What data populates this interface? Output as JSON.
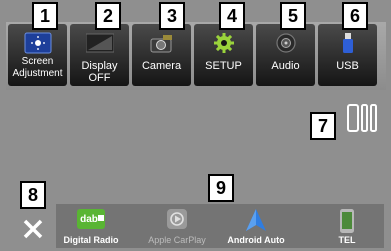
{
  "top_menu": [
    {
      "number": "1",
      "label": "Screen Adjustment",
      "icon": "screen-adjust-icon"
    },
    {
      "number": "2",
      "label": "Display OFF",
      "icon": "display-off-icon"
    },
    {
      "number": "3",
      "label": "Camera",
      "icon": "camera-icon"
    },
    {
      "number": "4",
      "label": "SETUP",
      "icon": "gear-icon"
    },
    {
      "number": "5",
      "label": "Audio",
      "icon": "speaker-icon"
    },
    {
      "number": "6",
      "label": "USB",
      "icon": "usb-icon"
    }
  ],
  "callouts": {
    "phone": "7",
    "close": "8",
    "dock": "9"
  },
  "dock": [
    {
      "label": "Digital Radio",
      "icon": "dab-icon",
      "enabled": true
    },
    {
      "label": "Apple CarPlay",
      "icon": "carplay-icon",
      "enabled": false
    },
    {
      "label": "Android Auto",
      "icon": "android-auto-icon",
      "enabled": true
    },
    {
      "label": "TEL",
      "icon": "phone-icon",
      "enabled": true
    }
  ],
  "colors": {
    "background": "#8f8f8f",
    "tile": "#151515",
    "dock": "#747474",
    "dab_green": "#59b533",
    "aa_blue": "#2f7de1"
  }
}
